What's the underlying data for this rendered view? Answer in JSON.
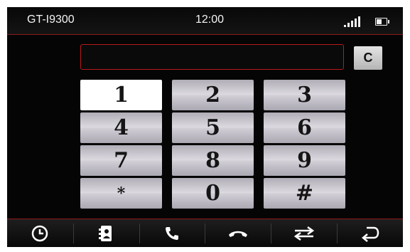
{
  "status": {
    "device_name": "GT-I9300",
    "time": "12:00"
  },
  "dialer": {
    "number": "",
    "clear_label": "C",
    "keys": [
      "1",
      "2",
      "3",
      "4",
      "5",
      "6",
      "7",
      "8",
      "9",
      "*",
      "0",
      "#"
    ]
  },
  "bottom_bar": {
    "items": [
      {
        "icon": "clock-icon"
      },
      {
        "icon": "contacts-icon"
      },
      {
        "icon": "phone-call-icon"
      },
      {
        "icon": "hang-up-icon"
      },
      {
        "icon": "transfer-icon"
      },
      {
        "icon": "back-icon"
      }
    ]
  },
  "colors": {
    "accent": "#b71a1a",
    "key_bg": "#d0cdd4",
    "active_key_bg": "#ffffff"
  }
}
